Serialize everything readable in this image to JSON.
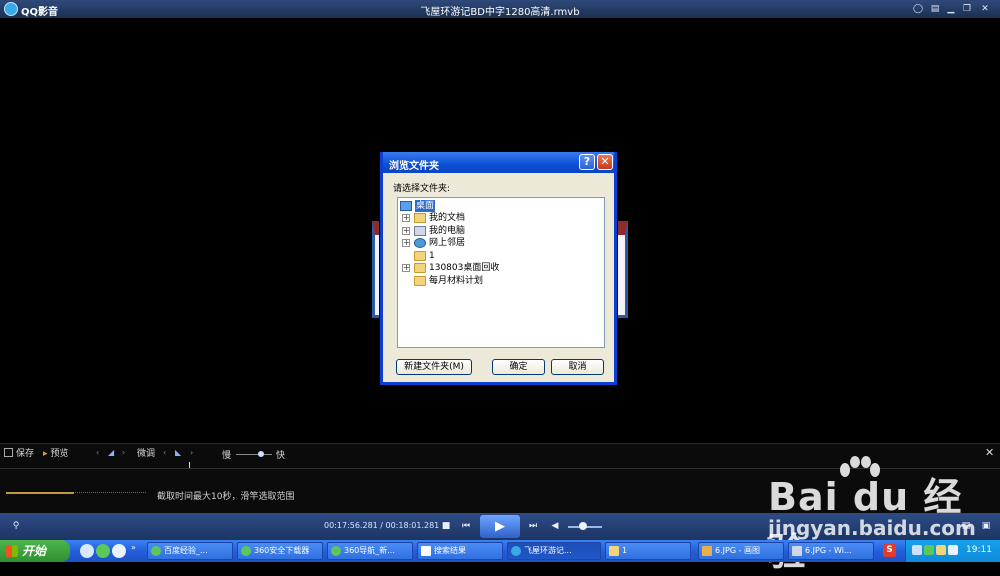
{
  "app": {
    "name": "QQ影音",
    "file_title": "飞屋环游记BD中字1280高清.rmvb"
  },
  "title_buttons": [
    "chat-icon",
    "menu-icon",
    "minimize-icon",
    "restore-icon",
    "close-icon"
  ],
  "dialog": {
    "title": "浏览文件夹",
    "help": "?",
    "close": "✕",
    "prompt": "请选择文件夹:",
    "tree": [
      {
        "label": "桌面",
        "expander": "",
        "selected": true,
        "icon": "desktop"
      },
      {
        "label": "我的文档",
        "expander": "+",
        "icon": "documents"
      },
      {
        "label": "我的电脑",
        "expander": "+",
        "icon": "computer"
      },
      {
        "label": "网上邻居",
        "expander": "+",
        "icon": "network"
      },
      {
        "label": "1",
        "expander": "",
        "icon": "folder"
      },
      {
        "label": "130803桌面回收",
        "expander": "+",
        "icon": "folder"
      },
      {
        "label": "每月材料计划",
        "expander": "",
        "icon": "folder"
      }
    ],
    "new_folder": "新建文件夹(M)",
    "ok": "确定",
    "cancel": "取消"
  },
  "capture": {
    "save": "保存",
    "preview": "预览",
    "fine_tune": "微调",
    "slow": "慢",
    "fast": "快",
    "hint": "截取时间最大10秒，滑竿选取范围",
    "close": "✕"
  },
  "player": {
    "current_time": "00:17:56.281",
    "total_time": "00:18:01.281",
    "time_sep": " / ",
    "volume_fraction": 0.45
  },
  "taskbar": {
    "start": "开始",
    "tasks": [
      {
        "label": "百度经验_...",
        "color": "#5cc85c"
      },
      {
        "label": "360安全下载器",
        "color": "#5cc85c"
      },
      {
        "label": "360导航_新...",
        "color": "#5cc85c"
      },
      {
        "label": "搜索结果",
        "color": "#ffffff"
      },
      {
        "label": "飞屋环游记...",
        "color": "#39a9e8",
        "active": true
      },
      {
        "label": "1",
        "color": "#f3d37c"
      },
      {
        "label": "6.JPG - 画图",
        "color": "#e8b04a"
      },
      {
        "label": "6.JPG - Wi...",
        "color": "#cfd8e4"
      }
    ],
    "clock": "19:11"
  },
  "watermark": {
    "logo": "Bai du 经验",
    "url": "jingyan.baidu.com"
  }
}
